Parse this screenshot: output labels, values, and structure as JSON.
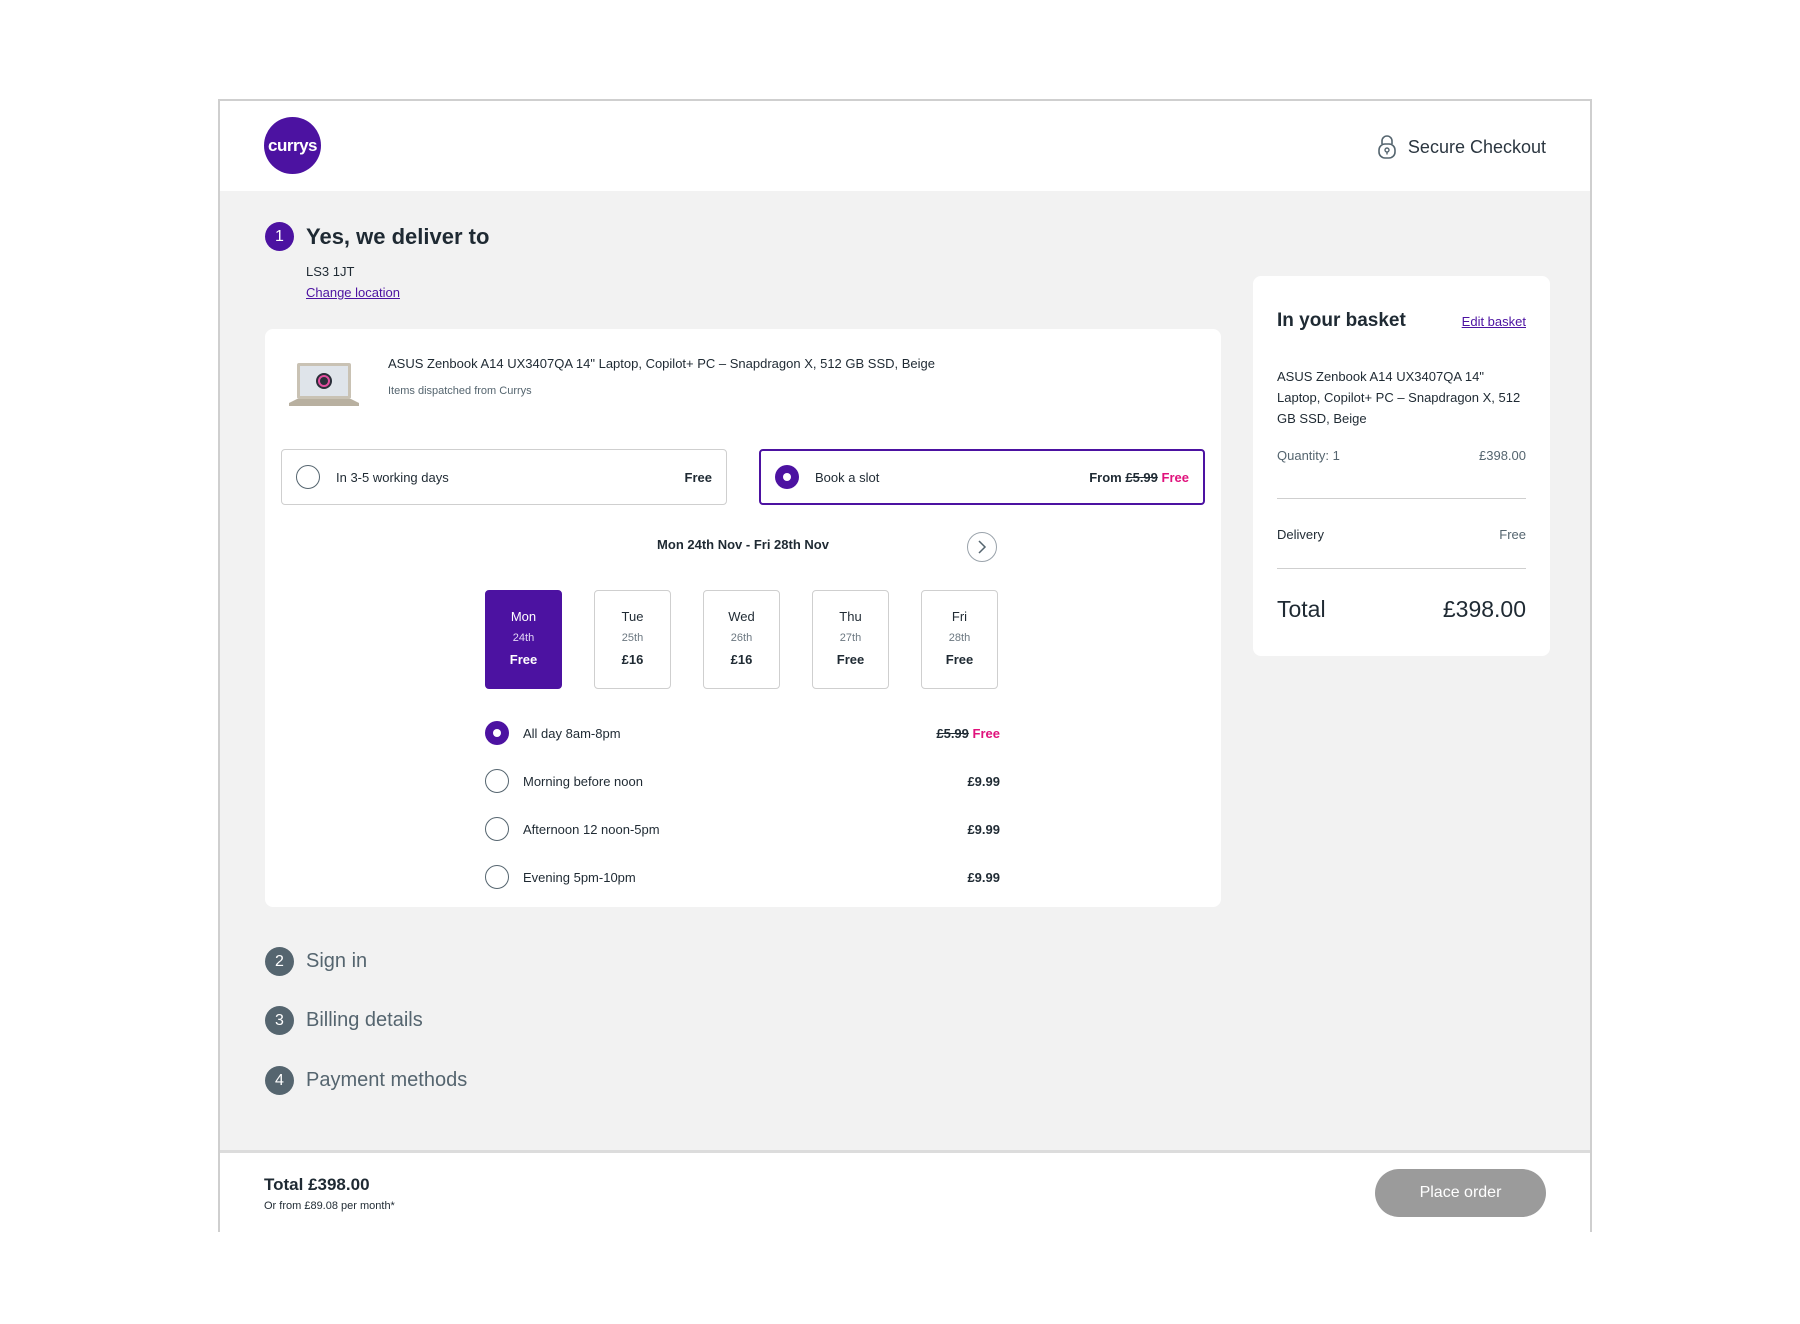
{
  "header": {
    "logo_text": "currys",
    "secure_label": "Secure Checkout"
  },
  "delivery": {
    "step_num": "1",
    "title": "Yes, we deliver to",
    "postcode": "LS3 1JT",
    "change_link": "Change location"
  },
  "product": {
    "name": "ASUS Zenbook A14 UX3407QA 14\" Laptop, Copilot+ PC – Snapdragon X, 512 GB SSD, Beige",
    "dispatch": "Items dispatched from Currys"
  },
  "options": {
    "standard": {
      "label": "In 3-5 working days",
      "price": "Free"
    },
    "slot": {
      "label": "Book a slot",
      "from": "From",
      "old_price": "£5.99",
      "price": "Free"
    }
  },
  "week": {
    "range": "Mon 24th Nov - Fri 28th Nov"
  },
  "days": [
    {
      "name": "Mon",
      "date": "24th",
      "price": "Free"
    },
    {
      "name": "Tue",
      "date": "25th",
      "price": "£16"
    },
    {
      "name": "Wed",
      "date": "26th",
      "price": "£16"
    },
    {
      "name": "Thu",
      "date": "27th",
      "price": "Free"
    },
    {
      "name": "Fri",
      "date": "28th",
      "price": "Free"
    }
  ],
  "slots": [
    {
      "label": "All day 8am-8pm",
      "old_price": "£5.99",
      "price": "Free"
    },
    {
      "label": "Morning before noon",
      "price": "£9.99"
    },
    {
      "label": "Afternoon 12 noon-5pm",
      "price": "£9.99"
    },
    {
      "label": "Evening 5pm-10pm",
      "price": "£9.99"
    }
  ],
  "steps": [
    {
      "num": "2",
      "title": "Sign in"
    },
    {
      "num": "3",
      "title": "Billing details"
    },
    {
      "num": "4",
      "title": "Payment methods"
    }
  ],
  "basket": {
    "title": "In your basket",
    "edit": "Edit basket",
    "product": "ASUS Zenbook A14 UX3407QA 14\" Laptop, Copilot+ PC – Snapdragon X, 512 GB SSD, Beige",
    "quantity": "Quantity: 1",
    "item_price": "£398.00",
    "delivery_label": "Delivery",
    "delivery_price": "Free",
    "total_label": "Total",
    "total": "£398.00"
  },
  "footer": {
    "total": "Total £398.00",
    "monthly": "Or from £89.08 per month*",
    "place_order": "Place order"
  },
  "colors": {
    "brand": "#4c12a1",
    "promo": "#e0127c",
    "disabled_button": "#9b9b9b"
  }
}
